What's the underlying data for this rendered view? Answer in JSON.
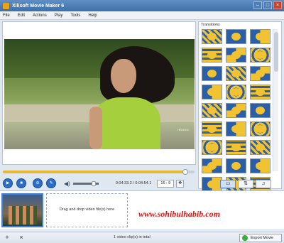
{
  "window": {
    "title": "Xilisoft Movie Maker 6",
    "minimize": "–",
    "maximize": "□",
    "close": "×"
  },
  "menu": [
    "File",
    "Edit",
    "Actions",
    "Play",
    "Tools",
    "Help"
  ],
  "player": {
    "watermark_small": "HD 6:8:1",
    "progress": 0.95,
    "volume": 0.8,
    "time_current": "0:04:33.2",
    "time_total": "0:04:54.1",
    "time_separator": " / ",
    "aspect_ratio": "16 : 9",
    "controls": {
      "play": "▶",
      "stop": "■",
      "prev": "⊘",
      "next": "✎",
      "volume_icon": "◀)",
      "snapshot": "✥"
    }
  },
  "transitions": {
    "title": "Transitions",
    "tiles": [
      "t1",
      "t2",
      "t3",
      "t4",
      "t5",
      "t6",
      "t2",
      "t1",
      "t5",
      "t3",
      "t6",
      "t4",
      "t1",
      "t5",
      "t2",
      "t4",
      "t3",
      "t6",
      "t6",
      "t4",
      "t1",
      "t5",
      "t2",
      "t3",
      "t3",
      "t1",
      "t4",
      "t2",
      "t6",
      "t5"
    ],
    "tabs": [
      "▭",
      "⇅",
      "♫"
    ]
  },
  "timeline": {
    "drop_text": "Drag and drop video file(s) here",
    "watermark": "www.sohibulhabib.com"
  },
  "status": {
    "add": "+",
    "remove": "×",
    "clip_count": "1 video clip(s) in total",
    "export_label": "Export Movie"
  }
}
